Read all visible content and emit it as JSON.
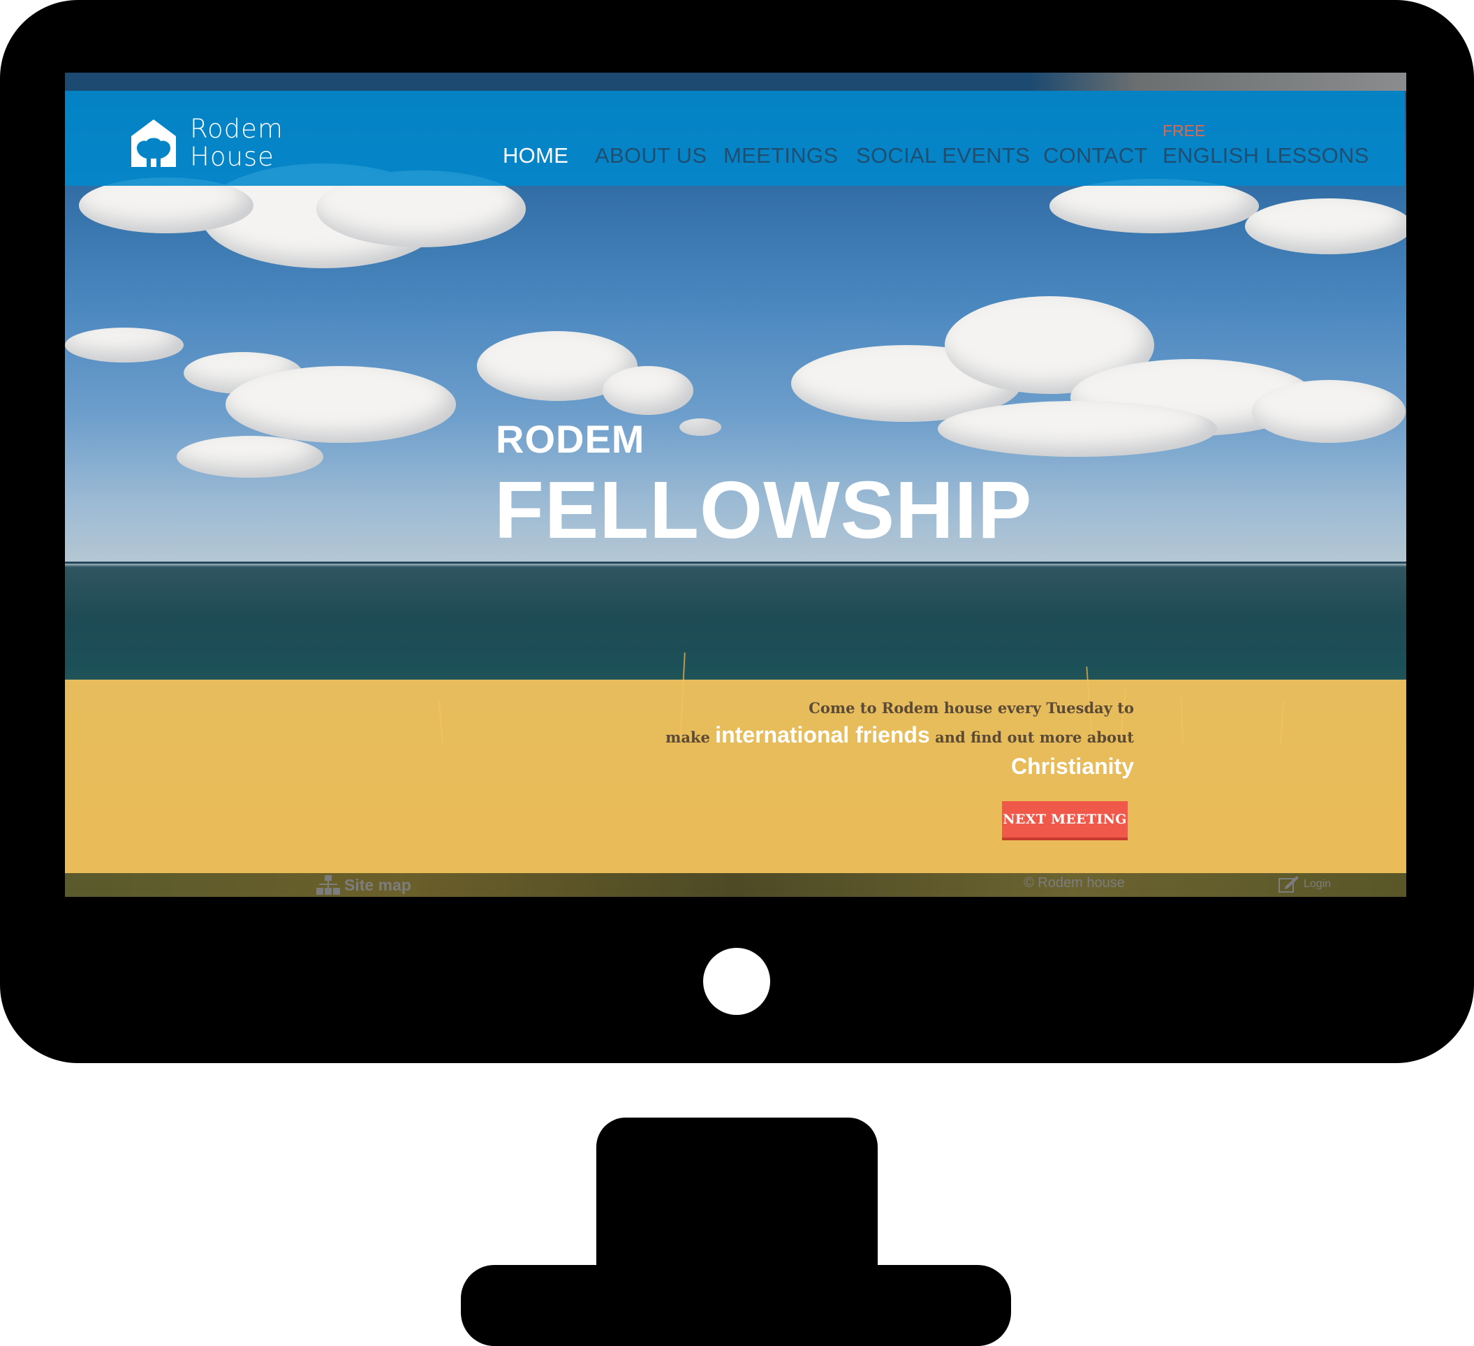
{
  "site": {
    "logo_line1": "Rodem",
    "logo_line2": "House"
  },
  "nav": {
    "items": [
      {
        "label": "HOME",
        "active": true
      },
      {
        "label": "ABOUT US",
        "active": false
      },
      {
        "label": "MEETINGS",
        "active": false
      },
      {
        "label": "SOCIAL EVENTS",
        "active": false
      },
      {
        "label": "CONTACT",
        "active": false
      },
      {
        "label": "ENGLISH LESSONS",
        "active": false
      }
    ],
    "english_badge": "FREE"
  },
  "hero": {
    "line1": "RODEM",
    "line2": "FELLOWSHIP"
  },
  "band": {
    "line1": "Come to Rodem house every Tuesday to",
    "line2_pre": "make",
    "line2_highlight": "international friends",
    "line2_post": "and find out more about",
    "line3": "Christianity",
    "button": "NEXT MEETING"
  },
  "footer": {
    "sitemap": "Site map",
    "copyright": "© Rodem house",
    "login": "Login"
  },
  "colors": {
    "header": "#0089cd",
    "band": "#f5c45c",
    "button": "#f0594a",
    "badge": "#e2674a"
  },
  "icons": {
    "logo": "house-tree-icon",
    "sitemap": "sitemap-icon",
    "login": "edit-icon"
  }
}
